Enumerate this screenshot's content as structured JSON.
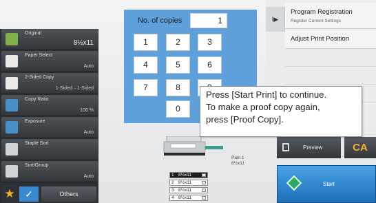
{
  "functions": [
    {
      "name": "Original",
      "value": "8½x11",
      "icon": "original-icon"
    },
    {
      "name": "Paper Select",
      "value": "Auto",
      "icon": "paper-select-icon"
    },
    {
      "name": "2-Sided Copy",
      "value": "1-Sided→1-Sided",
      "icon": "two-sided-icon"
    },
    {
      "name": "Copy Ratio",
      "value": "100 %",
      "icon": "copy-ratio-icon"
    },
    {
      "name": "Exposure",
      "value": "Auto",
      "icon": "exposure-icon"
    },
    {
      "name": "Staple Sort",
      "value": "",
      "icon": "staple-sort-icon"
    },
    {
      "name": "Sort/Group",
      "value": "Auto",
      "icon": "sort-group-icon"
    }
  ],
  "bottom": {
    "star": "★",
    "check": "✓",
    "others": "Others"
  },
  "keypad": {
    "label": "No. of copies",
    "display": "1",
    "keys": [
      "1",
      "2",
      "3",
      "4",
      "5",
      "6",
      "7",
      "8",
      "9",
      "0"
    ]
  },
  "right_panel": {
    "toggle": "I▶",
    "program_registration": "Program Registration",
    "program_sub": "Register Current Settings",
    "adjust_print_position": "Adjust Print Position"
  },
  "tooltip": {
    "line1": "Press [Start Print] to continue.",
    "line2": "To make a proof copy again,",
    "line3": "press [Proof Copy]."
  },
  "machine": {
    "paper_label": "Pain 1",
    "paper_size": "8½x11",
    "trays": [
      {
        "num": "1",
        "size": "8½x11"
      },
      {
        "num": "2",
        "size": "8½x11"
      },
      {
        "num": "3",
        "size": "8½x11"
      },
      {
        "num": "4",
        "size": "8½x11"
      }
    ]
  },
  "actions": {
    "preview": "Preview",
    "ca": "CA",
    "start": "Start"
  },
  "colors": {
    "keypad": "#5fa0da",
    "start": "#1e6fb6",
    "accent_star": "#f2b233"
  }
}
